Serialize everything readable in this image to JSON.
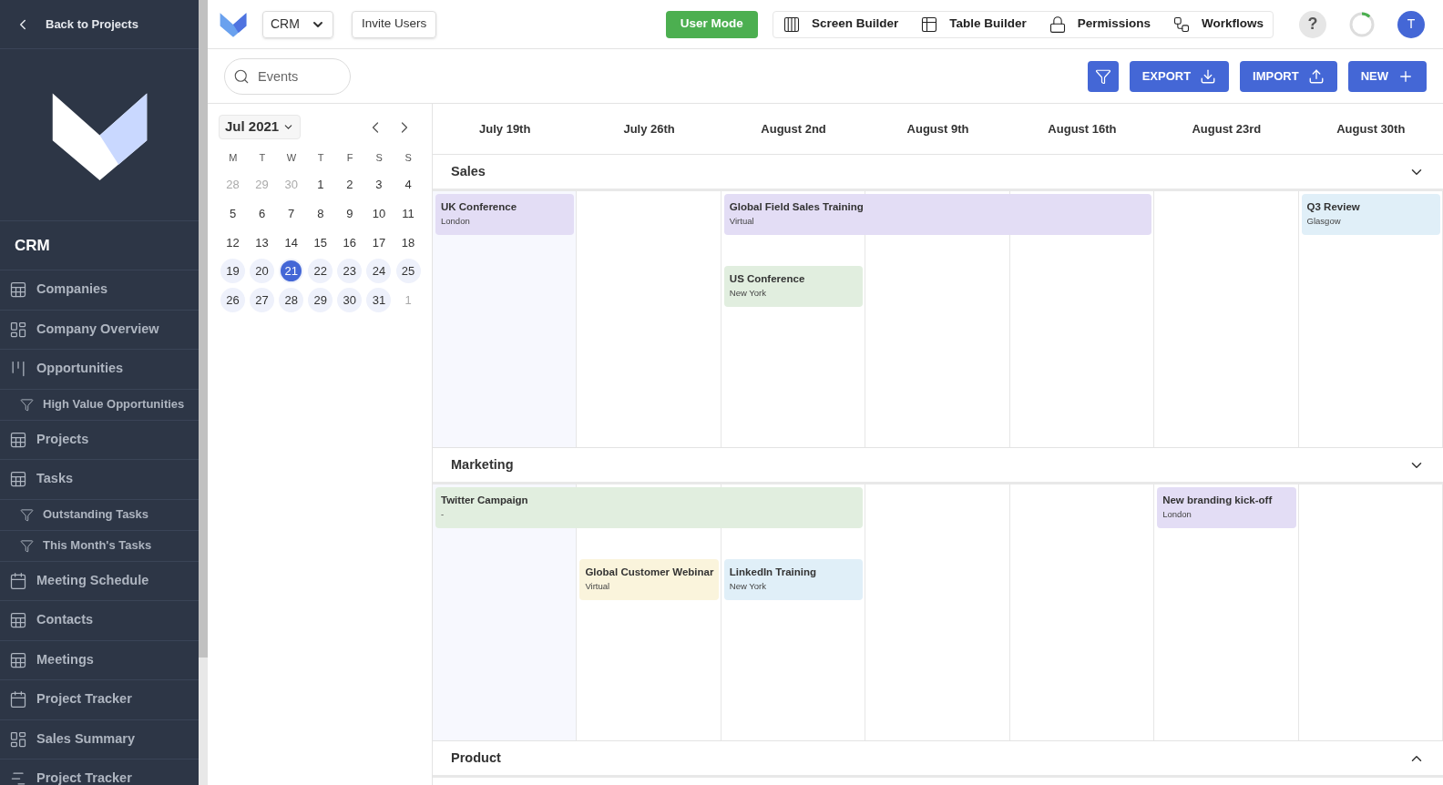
{
  "sidebar": {
    "back_link": "Back to Projects",
    "app_title": "CRM",
    "items": [
      {
        "label": "Companies",
        "kind": "table"
      },
      {
        "label": "Company Overview",
        "kind": "dashboard"
      },
      {
        "label": "Opportunities",
        "kind": "kanban"
      },
      {
        "label": "High Value Opportunities",
        "kind": "filter"
      },
      {
        "label": "Projects",
        "kind": "table"
      },
      {
        "label": "Tasks",
        "kind": "table"
      },
      {
        "label": "Outstanding Tasks",
        "kind": "filter"
      },
      {
        "label": "This Month's Tasks",
        "kind": "filter"
      },
      {
        "label": "Meeting Schedule",
        "kind": "calendar"
      },
      {
        "label": "Contacts",
        "kind": "table"
      },
      {
        "label": "Meetings",
        "kind": "table"
      },
      {
        "label": "Project Tracker",
        "kind": "calendar"
      },
      {
        "label": "Sales Summary",
        "kind": "dashboard"
      },
      {
        "label": "Project Tracker",
        "kind": "gantt"
      }
    ]
  },
  "topbar": {
    "app_selector": "CRM",
    "invite_button": "Invite Users",
    "mode_button": "User Mode",
    "tools": [
      {
        "label": "Screen Builder",
        "kind": "columns"
      },
      {
        "label": "Table Builder",
        "kind": "tables"
      },
      {
        "label": "Permissions",
        "kind": "lock"
      },
      {
        "label": "Workflows",
        "kind": "flow"
      }
    ],
    "help": "?",
    "progress": {
      "level": 0.12
    },
    "avatar": "T"
  },
  "toolbar": {
    "search": {
      "placeholder": "Events"
    },
    "buttons": [
      {
        "label": "EXPORT",
        "kind": "export"
      },
      {
        "label": "IMPORT",
        "kind": "import"
      },
      {
        "label": "NEW",
        "kind": "new"
      }
    ]
  },
  "mini_calendar": {
    "month": "Jul 2021",
    "weekdays": [
      "M",
      "T",
      "W",
      "T",
      "F",
      "S",
      "S"
    ],
    "days": [
      {
        "label": "28",
        "muted": true,
        "highlighted": false,
        "selected": false
      },
      {
        "label": "29",
        "muted": true,
        "highlighted": false,
        "selected": false
      },
      {
        "label": "30",
        "muted": true,
        "highlighted": false,
        "selected": false
      },
      {
        "label": "1",
        "muted": false,
        "highlighted": false,
        "selected": false
      },
      {
        "label": "2",
        "muted": false,
        "highlighted": false,
        "selected": false
      },
      {
        "label": "3",
        "muted": false,
        "highlighted": false,
        "selected": false
      },
      {
        "label": "4",
        "muted": false,
        "highlighted": false,
        "selected": false
      },
      {
        "label": "5",
        "muted": false,
        "highlighted": false,
        "selected": false
      },
      {
        "label": "6",
        "muted": false,
        "highlighted": false,
        "selected": false
      },
      {
        "label": "7",
        "muted": false,
        "highlighted": false,
        "selected": false
      },
      {
        "label": "8",
        "muted": false,
        "highlighted": false,
        "selected": false
      },
      {
        "label": "9",
        "muted": false,
        "highlighted": false,
        "selected": false
      },
      {
        "label": "10",
        "muted": false,
        "highlighted": false,
        "selected": false
      },
      {
        "label": "11",
        "muted": false,
        "highlighted": false,
        "selected": false
      },
      {
        "label": "12",
        "muted": false,
        "highlighted": false,
        "selected": false
      },
      {
        "label": "13",
        "muted": false,
        "highlighted": false,
        "selected": false
      },
      {
        "label": "14",
        "muted": false,
        "highlighted": false,
        "selected": false
      },
      {
        "label": "15",
        "muted": false,
        "highlighted": false,
        "selected": false
      },
      {
        "label": "16",
        "muted": false,
        "highlighted": false,
        "selected": false
      },
      {
        "label": "17",
        "muted": false,
        "highlighted": false,
        "selected": false
      },
      {
        "label": "18",
        "muted": false,
        "highlighted": false,
        "selected": false
      },
      {
        "label": "19",
        "muted": false,
        "highlighted": true,
        "selected": false
      },
      {
        "label": "20",
        "muted": false,
        "highlighted": true,
        "selected": false
      },
      {
        "label": "21",
        "muted": false,
        "highlighted": true,
        "selected": true
      },
      {
        "label": "22",
        "muted": false,
        "highlighted": true,
        "selected": false
      },
      {
        "label": "23",
        "muted": false,
        "highlighted": true,
        "selected": false
      },
      {
        "label": "24",
        "muted": false,
        "highlighted": true,
        "selected": false
      },
      {
        "label": "25",
        "muted": false,
        "highlighted": true,
        "selected": false
      },
      {
        "label": "26",
        "muted": false,
        "highlighted": true,
        "selected": false
      },
      {
        "label": "27",
        "muted": false,
        "highlighted": true,
        "selected": false
      },
      {
        "label": "28",
        "muted": false,
        "highlighted": true,
        "selected": false
      },
      {
        "label": "29",
        "muted": false,
        "highlighted": true,
        "selected": false
      },
      {
        "label": "30",
        "muted": false,
        "highlighted": true,
        "selected": false
      },
      {
        "label": "31",
        "muted": false,
        "highlighted": true,
        "selected": false
      },
      {
        "label": "1",
        "muted": true,
        "highlighted": false,
        "selected": false
      }
    ]
  },
  "timeline": {
    "columns": [
      {
        "label": "July 19th",
        "current": true
      },
      {
        "label": "July 26th",
        "current": false
      },
      {
        "label": "August 2nd",
        "current": false
      },
      {
        "label": "August 9th",
        "current": false
      },
      {
        "label": "August 16th",
        "current": false
      },
      {
        "label": "August 23rd",
        "current": false
      },
      {
        "label": "August 30th",
        "current": false
      }
    ],
    "groups": [
      {
        "name": "Sales",
        "expanded": true,
        "lanes": [
          [
            {
              "kind": "event",
              "title": "UK Conference",
              "place": "London",
              "color": "#e3ddf5"
            },
            {
              "kind": "empty"
            },
            {
              "kind": "event",
              "title": "Global Field Sales Training",
              "place": "Virtual",
              "color": "#e3ddf5"
            },
            {
              "kind": "continued"
            },
            {
              "kind": "continued"
            },
            {
              "kind": "empty"
            },
            {
              "kind": "event",
              "title": "Q3 Review",
              "place": "Glasgow",
              "color": "#e0eff8"
            }
          ],
          [
            {
              "kind": "empty"
            },
            {
              "kind": "empty"
            },
            {
              "kind": "event",
              "title": "US Conference",
              "place": "New York",
              "color": "#e1eedf"
            },
            {
              "kind": "empty"
            },
            {
              "kind": "empty"
            },
            {
              "kind": "empty"
            },
            {
              "kind": "empty"
            }
          ]
        ]
      },
      {
        "name": "Marketing",
        "expanded": true,
        "lanes": [
          [
            {
              "kind": "event",
              "title": "Twitter Campaign",
              "place": "-",
              "color": "#e1eedf"
            },
            {
              "kind": "continued"
            },
            {
              "kind": "continued"
            },
            {
              "kind": "empty"
            },
            {
              "kind": "empty"
            },
            {
              "kind": "event",
              "title": "New branding kick-off",
              "place": "London",
              "color": "#e3ddf5"
            },
            {
              "kind": "empty"
            }
          ],
          [
            {
              "kind": "empty"
            },
            {
              "kind": "event",
              "title": "Global Customer Webinar",
              "place": "Virtual",
              "color": "#faf4dc"
            },
            {
              "kind": "event",
              "title": "LinkedIn Training",
              "place": "New York",
              "color": "#e0eff8"
            },
            {
              "kind": "empty"
            },
            {
              "kind": "empty"
            },
            {
              "kind": "empty"
            },
            {
              "kind": "empty"
            }
          ]
        ]
      },
      {
        "name": "Product",
        "expanded": false
      }
    ]
  }
}
